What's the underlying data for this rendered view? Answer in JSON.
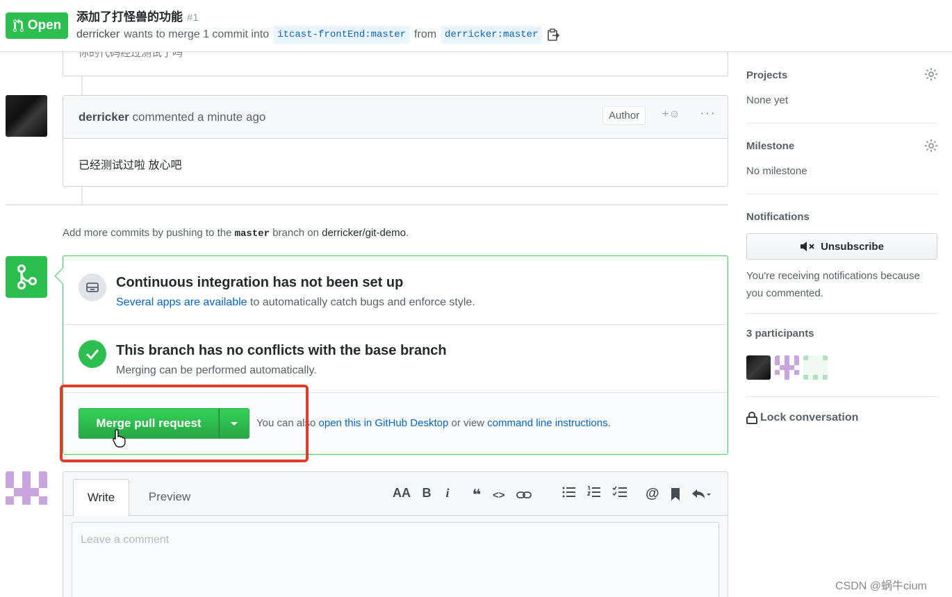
{
  "header": {
    "state": "Open",
    "title": "添加了打怪兽的功能",
    "number": "#1",
    "author": "derricker",
    "meta_text": "wants to merge 1 commit into",
    "base_branch": "itcast-frontEnd:master",
    "from_text": "from",
    "head_branch": "derricker:master"
  },
  "timeline": {
    "prev_comment_fragment": "你的代码经过测试了吗",
    "comment": {
      "author": "derricker",
      "action": "commented a minute ago",
      "role_badge": "Author",
      "body": "已经测试过啦 放心吧"
    },
    "push_hint": {
      "prefix": "Add more commits by pushing to the",
      "branch": "master",
      "middle": "branch on",
      "repo": "derricker/git-demo",
      "suffix": "."
    }
  },
  "merge_box": {
    "ci_title": "Continuous integration has not been set up",
    "ci_link_1": "Several apps",
    "ci_link_2": "are available",
    "ci_text": "to automatically catch bugs and enforce style.",
    "conflict_title": "This branch has no conflicts with the base branch",
    "conflict_sub": "Merging can be performed automatically.",
    "merge_button": "Merge pull request",
    "hint_prefix": "You can also",
    "hint_link_1": "open this in GitHub Desktop",
    "hint_middle": "or view",
    "hint_link_2": "command line instructions",
    "hint_suffix": "."
  },
  "editor": {
    "tab_write": "Write",
    "tab_preview": "Preview",
    "toolbar": {
      "heading": "AA",
      "bold": "B",
      "italic": "i",
      "quote": "❝",
      "code": "<>"
    },
    "placeholder": "Leave a comment"
  },
  "sidebar": {
    "projects_label": "Projects",
    "projects_value": "None yet",
    "milestone_label": "Milestone",
    "milestone_value": "No milestone",
    "notifications_label": "Notifications",
    "unsubscribe_button": "Unsubscribe",
    "notifications_note": "You're receiving notifications because you commented.",
    "participants_label": "3 participants",
    "lock_label": "Lock conversation"
  },
  "watermark": "CSDN @蜗牛cium",
  "colors": {
    "green": "#2cbe4e",
    "link": "#0366d6",
    "highlight_box": "#e03e2d"
  }
}
